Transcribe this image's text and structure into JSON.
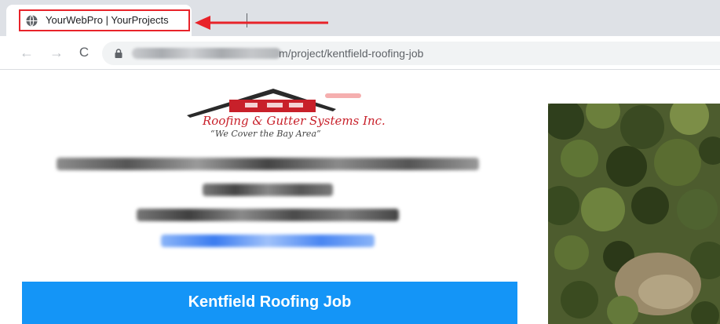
{
  "browser": {
    "tab": {
      "title": "YourWebPro | YourProjects",
      "favicon": "globe-icon"
    },
    "toolbar": {
      "back_icon": "arrow-left-icon",
      "forward_icon": "arrow-right-icon",
      "reload_icon": "reload-icon",
      "lock_icon": "lock-icon",
      "url_visible_suffix": "m/project/kentfield-roofing-job"
    },
    "annotation": {
      "color": "#e8232a"
    }
  },
  "page": {
    "logo": {
      "line1": "Roofing & Gutter Systems Inc.",
      "line2": "“We Cover the Bay Area”"
    },
    "banner": {
      "title": "Kentfield Roofing Job",
      "color": "#1495f7"
    }
  }
}
